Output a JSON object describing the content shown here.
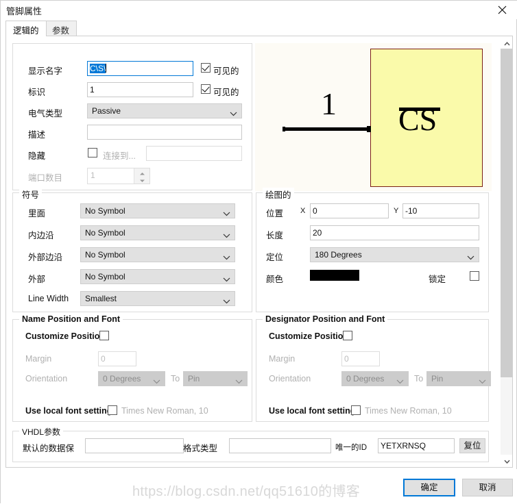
{
  "window": {
    "title": "管脚属性",
    "close_icon": "close-icon"
  },
  "tabs": [
    {
      "label": "逻辑的",
      "active": true
    },
    {
      "label": "参数",
      "active": false
    }
  ],
  "logical": {
    "display_name": {
      "label": "显示名字",
      "value": "C\\S\\",
      "visible_label": "可见的",
      "visible_checked": true
    },
    "designator": {
      "label": "标识",
      "value": "1",
      "visible_label": "可见的",
      "visible_checked": true
    },
    "electrical": {
      "label": "电气类型",
      "value": "Passive"
    },
    "description": {
      "label": "描述",
      "value": ""
    },
    "hidden": {
      "label": "隐藏",
      "checked": false,
      "connect_label": "连接到...",
      "connect_value": ""
    },
    "port_count": {
      "label": "端口数目",
      "value": "1",
      "disabled": true
    }
  },
  "symbol_group": {
    "title": "符号",
    "rows": [
      {
        "label": "里面",
        "value": "No Symbol"
      },
      {
        "label": "内边沿",
        "value": "No Symbol"
      },
      {
        "label": "外部边沿",
        "value": "No Symbol"
      },
      {
        "label": "外部",
        "value": "No Symbol"
      },
      {
        "label": "Line Width",
        "value": "Smallest"
      }
    ]
  },
  "graphical_group": {
    "title": "绘图的",
    "position_label": "位置",
    "x_label": "X",
    "x_value": "0",
    "y_label": "Y",
    "y_value": "-10",
    "length_label": "长度",
    "length_value": "20",
    "orientation_label": "定位",
    "orientation_value": "180 Degrees",
    "color_label": "颜色",
    "color_value": "#000000",
    "locked_label": "锁定",
    "locked_checked": false
  },
  "name_font_group": {
    "title": "Name Position and Font",
    "customize_label": "Customize Position",
    "customize_checked": false,
    "margin_label": "Margin",
    "margin_value": "0",
    "orientation_label": "Orientation",
    "orientation_value": "0 Degrees",
    "to_label": "To",
    "to_value": "Pin",
    "use_local_font_label": "Use local font setting",
    "use_local_font_checked": false,
    "font_desc": "Times New Roman, 10"
  },
  "designator_font_group": {
    "title": "Designator Position and Font",
    "customize_label": "Customize Position",
    "customize_checked": false,
    "margin_label": "Margin",
    "margin_value": "0",
    "orientation_label": "Orientation",
    "orientation_value": "0 Degrees",
    "to_label": "To",
    "to_value": "Pin",
    "use_local_font_label": "Use local font setting",
    "use_local_font_checked": false,
    "font_desc": "Times New Roman, 10"
  },
  "vhdl_group": {
    "title": "VHDL参数",
    "default_data_label": "默认的数据保",
    "default_data_value": "",
    "format_type_label": "格式类型",
    "format_type_value": "",
    "unique_id_label": "唯一的ID",
    "unique_id_value": "YETXRNSQ",
    "reset_label": "复位"
  },
  "preview": {
    "designator_text": "1",
    "part_text": "CS",
    "body_color": "#FAFAAA",
    "body_border_color": "#7A1F14",
    "background_color": "#FDFBF5"
  },
  "footer": {
    "ok_label": "确定",
    "cancel_label": "取消"
  },
  "watermark": {
    "text": "https://blog.csdn.net/qq51610的博客"
  }
}
